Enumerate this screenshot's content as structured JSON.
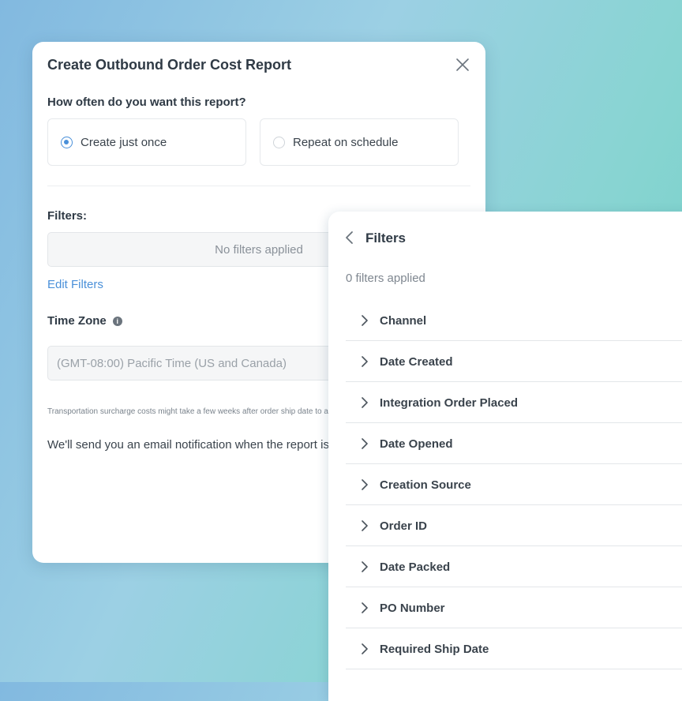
{
  "dialog": {
    "title": "Create Outbound Order Cost Report",
    "question": "How often do you want this report?",
    "options": [
      {
        "label": "Create just once",
        "selected": true
      },
      {
        "label": "Repeat on schedule",
        "selected": false
      }
    ],
    "filters_label": "Filters:",
    "filters_value": "No filters applied",
    "edit_filters": "Edit Filters",
    "timezone_label": "Time Zone",
    "timezone_value": "(GMT-08:00) Pacific Time (US and Canada)",
    "note": "Transportation surcharge costs might take a few weeks after order ship date to appear in the report.",
    "email_note": "We'll send you an email notification when the report is ready to download."
  },
  "panel": {
    "title": "Filters",
    "applied": "0 filters applied",
    "items": [
      "Channel",
      "Date Created",
      "Integration Order Placed",
      "Date Opened",
      "Creation Source",
      "Order ID",
      "Date Packed",
      "PO Number",
      "Required Ship Date"
    ]
  },
  "colors": {
    "accent": "#4a90d9",
    "text": "#2f3a45"
  }
}
